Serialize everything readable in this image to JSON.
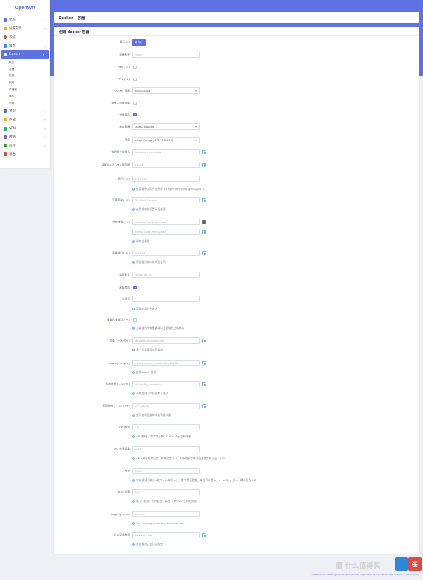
{
  "app": {
    "logo": "OpenWrt",
    "page_title": "Docker - 容器"
  },
  "sidebar": {
    "items": [
      {
        "label": "状态",
        "icon": "status-icon",
        "color": "#5e72e4"
      },
      {
        "label": "设置向导",
        "icon": "wizard-icon",
        "color": "#f5a623"
      },
      {
        "label": "系统",
        "icon": "system-icon",
        "color": "#e0492d"
      },
      {
        "label": "服务",
        "icon": "services-icon",
        "color": "#3b8fe0"
      },
      {
        "label": "Docker",
        "icon": "docker-icon",
        "color": "#ffffff",
        "active": true
      }
    ],
    "docker_sub": [
      "概览",
      "容器",
      "镜像",
      "网络",
      "存储卷",
      "事件",
      "设置"
    ],
    "items_after": [
      {
        "label": "管控",
        "icon": "control-icon",
        "color": "#4b6ed8"
      },
      {
        "label": "存储",
        "icon": "storage-icon",
        "color": "#f0b429"
      },
      {
        "label": "VPN",
        "icon": "vpn-icon",
        "color": "#28b463"
      },
      {
        "label": "网络",
        "icon": "network-icon",
        "color": "#7a5fd6"
      },
      {
        "label": "监控",
        "icon": "monitor-icon",
        "color": "#2ca02c"
      },
      {
        "label": "退出",
        "icon": "logout-icon",
        "color": "#d94a4a"
      }
    ]
  },
  "form": {
    "title": "创建 docker 容器",
    "import_label": "解析 CLI",
    "import_button": "命令行",
    "name_label": "容器名称",
    "name_placeholder": "cupid",
    "interactive_label": "交互 ( -i )",
    "tty_label": "TTY ( -t )",
    "image_label": "Docker 镜像",
    "image_value": "alluxio/cupid",
    "always_pull_label": "总是无拉取镜像",
    "privileged_label": "特权模式",
    "restart_label": "重启策略",
    "restart_value": "Unless stopped",
    "network_label": "网络",
    "network_value": "bridge (bridge | 172.17.0.1/16)",
    "alias_label": "在网络中的别名",
    "alias_placeholder": "container_name.alias",
    "dns_label": "设置自定义 DNS 服务器",
    "dns_placeholder": "8.8.8.8",
    "user_label": "用户 ( -u )",
    "user_placeholder": "1000:1000",
    "user_hint": "在容器中以用户运行命令 ( 格式name|uid[:group|gid] )",
    "env_label": "环境变量 ( -e )",
    "env_placeholder": "TZ=Asia/Shanghai",
    "env_hint": "在容器内部设置环境变量",
    "mount_label": "绑定挂载 ( -v )",
    "mount_placeholder_1": "/dev/fuse:/dev/fuse:rslave",
    "mount_placeholder_2": "/media:/data:/media/data",
    "mount_hint": "绑定挂载卷",
    "ports_label": "暴露端口 ( -p )",
    "ports_placeholder": "2200:22",
    "ports_hint": "将容器的端口发布到主机",
    "command_label": "运行命令",
    "command_placeholder": "/bin/sh init.sh",
    "advanced_label": "高级选项",
    "hostname_label": "主机名",
    "hostname_hint": "容器使用的主机名",
    "expose_all_label": "暴露所有端口 ( -P )",
    "expose_all_hint": "为容器的所有暴露端口分配随机主机端口",
    "device_label": "设备 ( --device )",
    "device_placeholder": "/dev/sda:/dev/xvdc:rwm",
    "device_hint": "将主机设备添加到容器",
    "tmpfs_label": "tmpfs ( --tmpfs )",
    "tmpfs_placeholder": "/run:rw,noexec,nosuid,size=65536k",
    "tmpfs_hint": "挂载 tmpfs 目录",
    "sysctl_label": "系统控制 ( --sysctl )",
    "sysctl_placeholder": "net.ipv4.ip_forward=1",
    "sysctl_hint": "系统控制 ( 内核参数 ) 选项",
    "cap_label": "权限控制 ( --cap-add )",
    "cap_placeholder": "NET_ADMIN",
    "cap_hint": "要添加到容器的内核功能列表",
    "cpus_label": "CPU数量",
    "cpus_placeholder": "1.5",
    "cpus_hint": "CPU 数量，数字是小数。0.000 表示没有限制",
    "cpu_shares_label": "CPU 共享权重",
    "cpu_shares_placeholder": "1024",
    "cpu_shares_hint": "CPU 共享相对权重，如果设置为 0，则系统将忽略该值并使用默认值 1024",
    "memory_label": "内存",
    "memory_placeholder": "128m",
    "memory_hint": "内存限制 ( 格式<数字>[<单位>] )，数字是正整数。单位可以是 b、k、m 或 g 之一。最小值为 4M",
    "blkio_label": "块 IO 权重",
    "blkio_placeholder": "500",
    "blkio_hint": "块 IO 权重 ( 相对权重 ) 接受10到1000之间的数值",
    "log_driver_label": "Logging driver",
    "log_driver_placeholder": "json-file",
    "log_driver_hint": "The logging driver for the container",
    "log_opts_label": "日志驱动选项",
    "log_opts_placeholder": "max-size=1m",
    "log_opts_hint": "该容器的日志记录配置"
  },
  "footer": "Powered by LuCI Master (git-22.014.34044-a5f9fde) / ArgonTheme v1.8.1 / OpenWrt Lean Plus R22.1.1 (for Goodboy)",
  "watermark": "值 什么值得买"
}
